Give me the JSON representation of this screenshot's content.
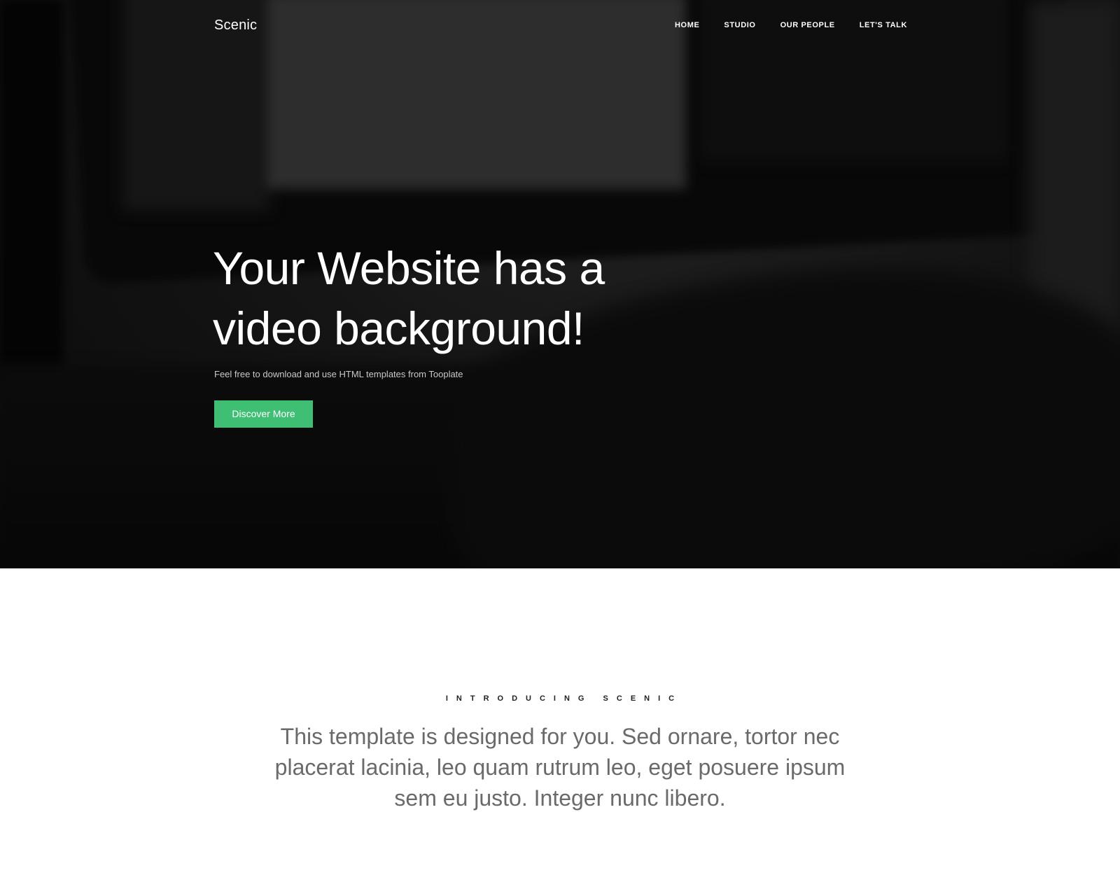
{
  "navbar": {
    "brand": "Scenic",
    "links": [
      "HOME",
      "STUDIO",
      "OUR PEOPLE",
      "LET'S TALK"
    ]
  },
  "hero": {
    "title_line1": "Your Website has a",
    "title_line2": "video background!",
    "subtitle": "Feel free to download and use HTML templates from Tooplate",
    "button_label": "Discover More"
  },
  "intro": {
    "kicker": "INTRODUCING SCENIC",
    "text": "This template is designed for you. Sed ornare, tortor nec placerat lacinia, leo quam rutrum leo, eget posuere ipsum sem eu justo. Integer nunc libero."
  },
  "colors": {
    "accent": "#3fbf73",
    "hero_text": "#ffffff",
    "body_text": "#6a6a6a"
  }
}
